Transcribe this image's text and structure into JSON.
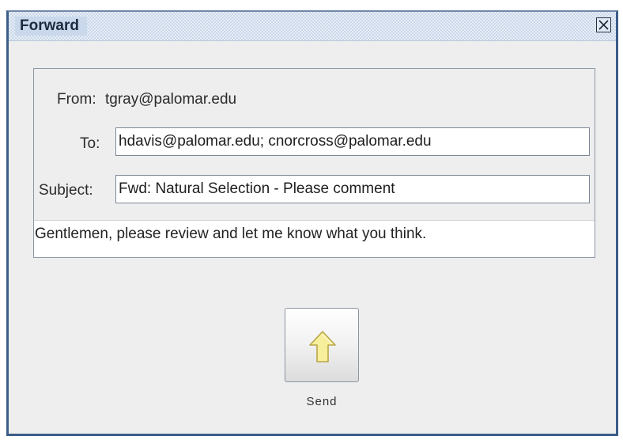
{
  "window": {
    "title": "Forward"
  },
  "form": {
    "from_label": "From:",
    "from_value": "tgray@palomar.edu",
    "to_label": "To:",
    "to_value": "hdavis@palomar.edu; cnorcross@palomar.edu",
    "subject_label": "Subject:",
    "subject_value": "Fwd: Natural Selection - Please comment",
    "body": "Gentlemen, please review and let me know what you think."
  },
  "actions": {
    "send_label": "Send",
    "send_icon": "up-arrow-icon"
  },
  "colors": {
    "title_bar": "#c9d8ea",
    "window_border": "#3d5d88",
    "background": "#eeeeee",
    "arrow_fill": "#f7ef9b"
  }
}
